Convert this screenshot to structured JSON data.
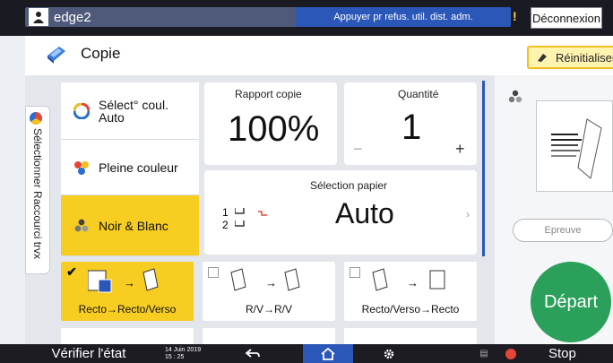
{
  "header": {
    "username": "edge2",
    "remote_message": "Appuyer pr refus. util. dist. adm.",
    "logout_label": "Déconnexion"
  },
  "app": {
    "title": "Copie",
    "reset_label": "Réinitialiser"
  },
  "side_tab": {
    "label": "Sélectionner Raccourci trvx"
  },
  "color_modes": [
    {
      "label": "Sélect° coul. Auto",
      "selected": false
    },
    {
      "label": "Pleine couleur",
      "selected": false
    },
    {
      "label": "Noir & Blanc",
      "selected": true
    }
  ],
  "ratio": {
    "label": "Rapport copie",
    "value": "100%"
  },
  "quantity": {
    "label": "Quantité",
    "value": "1",
    "minus": "−",
    "plus": "+"
  },
  "paper": {
    "label": "Sélection papier",
    "value": "Auto",
    "tray1": "1",
    "tray2": "2"
  },
  "duplex_options": [
    {
      "label": "Recto→Recto/Verso",
      "checked": true
    },
    {
      "label": "R/V→R/V",
      "checked": false
    },
    {
      "label": "Recto/Verso→Recto",
      "checked": false
    }
  ],
  "right_panel": {
    "proof_label": "Epreuve",
    "start_label": "Départ"
  },
  "footer": {
    "status_label": "Vérifier l'état",
    "date": "14 Juin 2019",
    "time": "15 : 25",
    "stop_label": "Stop"
  },
  "colors": {
    "accent_yellow": "#f7cd21",
    "accent_blue": "#2b57b8",
    "start_green": "#2aa05a"
  }
}
